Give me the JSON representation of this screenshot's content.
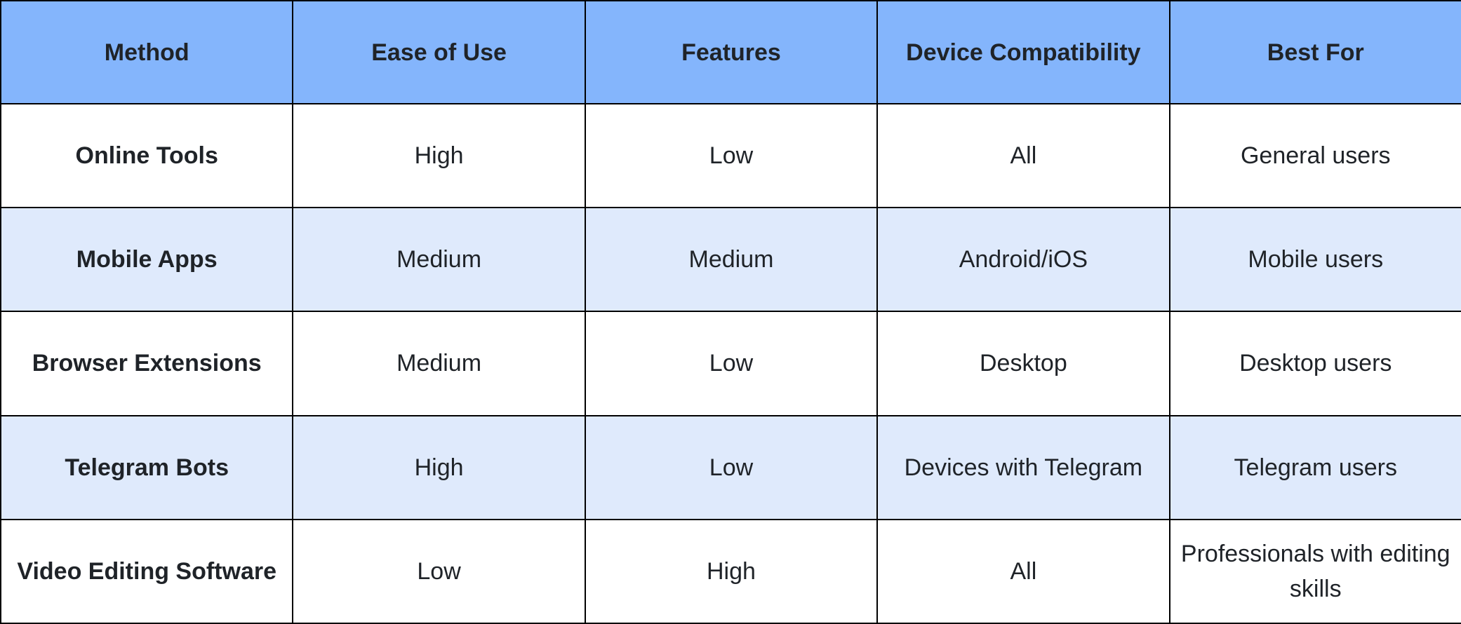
{
  "table": {
    "headers": [
      "Method",
      "Ease of Use",
      "Features",
      "Device Compatibility",
      "Best For"
    ],
    "rows": [
      [
        "Online Tools",
        "High",
        "Low",
        "All",
        "General users"
      ],
      [
        "Mobile Apps",
        "Medium",
        "Medium",
        "Android/iOS",
        "Mobile users"
      ],
      [
        "Browser Extensions",
        "Medium",
        "Low",
        "Desktop",
        "Desktop users"
      ],
      [
        "Telegram Bots",
        "High",
        "Low",
        "Devices with Telegram",
        "Telegram users"
      ],
      [
        "Video Editing Software",
        "Low",
        "High",
        "All",
        "Professionals with editing skills"
      ]
    ]
  },
  "colors": {
    "header_bg": "#84b5fc",
    "alt_row_bg": "#dfeafc",
    "row_bg": "#ffffff",
    "border": "#000000",
    "text": "#1f2328"
  }
}
